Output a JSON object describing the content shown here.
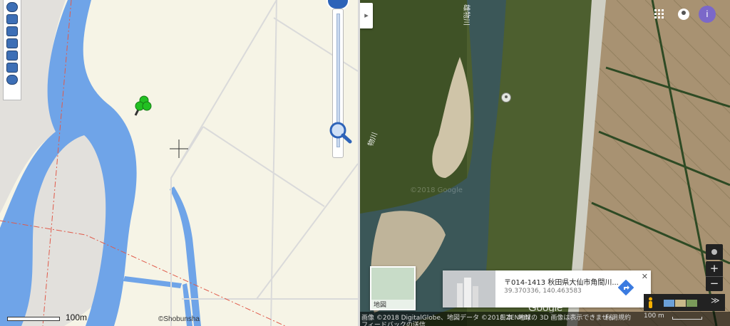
{
  "left_map": {
    "scale_label": "100m",
    "attribution": "©Shobunsha",
    "toolbar_icons": [
      "globe-icon",
      "layers-icon",
      "map-icon",
      "route-icon",
      "satellite-icon",
      "print-icon",
      "world-icon"
    ],
    "colors": {
      "land": "#f6f4e6",
      "water": "#6fa4e8",
      "sandbar": "#e2e0dc",
      "road": "#dadada",
      "boundary": "#e05a4a"
    }
  },
  "right_map": {
    "river_labels": [
      "雄物川",
      "物川"
    ],
    "watermark": "©2018 Google",
    "info_card": {
      "address": "〒014-1413 秋田県大仙市角間川...",
      "coordinates": "39.370336, 140.463583"
    },
    "mini_map_label": "地図",
    "google_logo": "Google",
    "zoom_in": "+",
    "zoom_out": "−",
    "footer": {
      "imagery": "画像 ©2018 DigitalGlobe、地図データ ©2018 ZENRIN",
      "country": "日本",
      "notice": "地球の 3D 画像は表示できません",
      "terms": "利用規約",
      "scale": "100 m",
      "feedback": "フィードバックの送信"
    },
    "accent_color": "#7b68c9"
  }
}
